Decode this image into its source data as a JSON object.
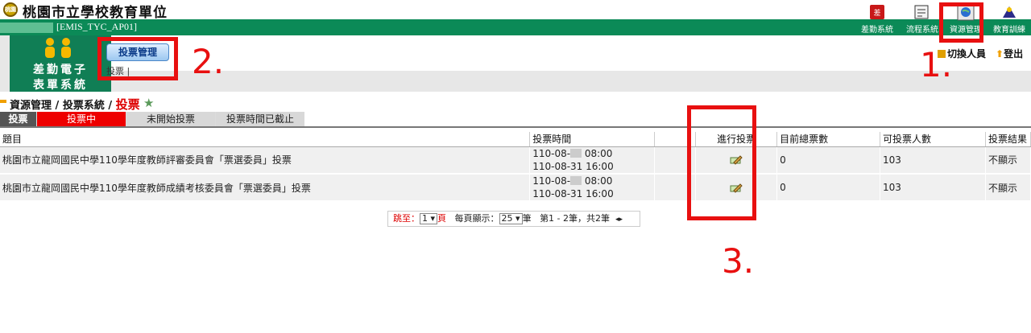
{
  "header": {
    "logo_text": "桃園",
    "site_title": "桃園市立學校教育單位",
    "account_id": "[EMIS_TYC_AP01]"
  },
  "nav": {
    "items": [
      {
        "label": "差勤系統",
        "icon": "attendance-icon"
      },
      {
        "label": "流程系統",
        "icon": "workflow-icon"
      },
      {
        "label": "資源管理",
        "icon": "globe-icon"
      },
      {
        "label": "教育訓練",
        "icon": "training-icon"
      }
    ]
  },
  "system": {
    "line1": "差勤電子",
    "line2": "表單系統"
  },
  "toolbar": {
    "mgmt_button": "投票管理",
    "sub_link": "投票 |",
    "switch_user": "切換人員",
    "logout": "登出"
  },
  "breadcrumb": {
    "part1": "資源管理",
    "sep": " / ",
    "part2": "投票系統",
    "current": "投票"
  },
  "tabs": {
    "main": "投票",
    "active": "投票中",
    "upcoming": "未開始投票",
    "closed": "投票時間已截止"
  },
  "table": {
    "headers": [
      "題目",
      "投票時間",
      "",
      "進行投票",
      "目前總票數",
      "可投票人數",
      "投票結果"
    ],
    "rows": [
      {
        "title": "桃園市立龍岡國民中學110學年度教師評審委員會「票選委員」投票",
        "start_prefix": "110-08-",
        "start_suffix": " 08:00",
        "end": "110-08-31 16:00",
        "total": "0",
        "eligible": "103",
        "result": "不顯示"
      },
      {
        "title": "桃園市立龍岡國民中學110學年度教師成績考核委員會「票選委員」投票",
        "start_prefix": "110-08-",
        "start_suffix": " 08:00",
        "end": "110-08-31 16:00",
        "total": "0",
        "eligible": "103",
        "result": "不顯示"
      }
    ]
  },
  "pager": {
    "goto_label": "跳至：",
    "page_value": "1",
    "page_unit": "頁",
    "per_page_label": "每頁顯示：",
    "per_page_value": "25",
    "per_page_unit": "筆",
    "summary": "第1 - 2筆，共2筆"
  },
  "annotations": {
    "n1": "1.",
    "n2": "2.",
    "n3": "3."
  },
  "colors": {
    "green": "#0b8a57",
    "accent_red": "#e81010",
    "active_tab": "#e00000"
  }
}
